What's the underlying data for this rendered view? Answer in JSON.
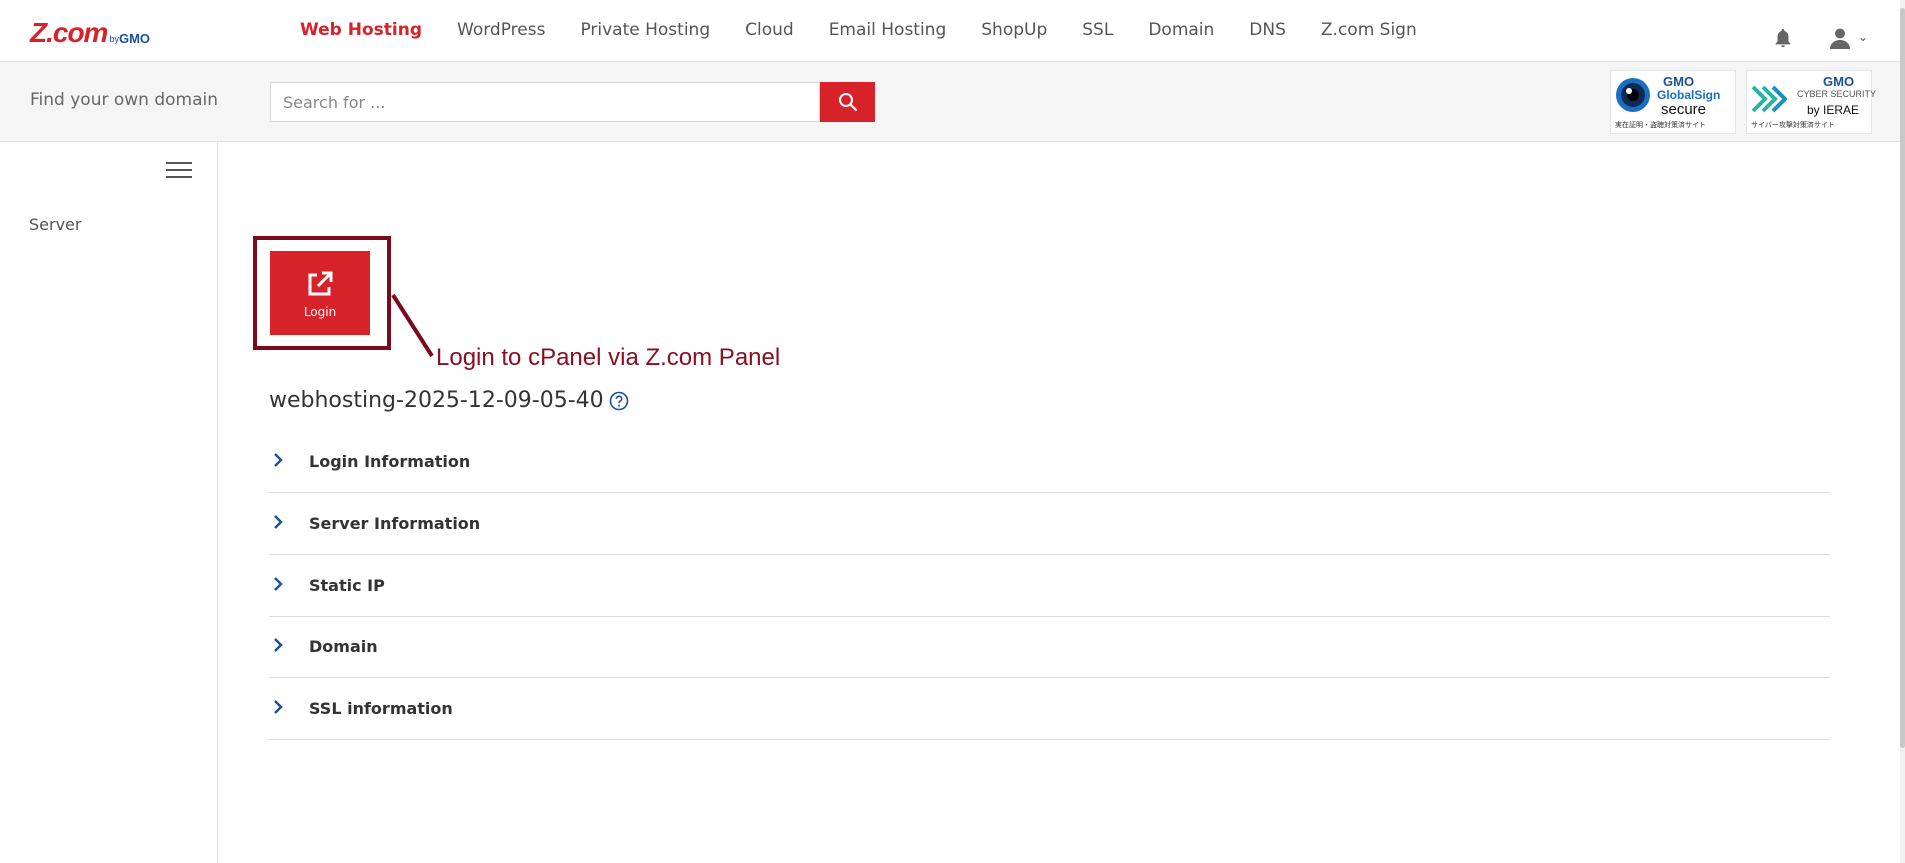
{
  "brand": {
    "logo_main": "Z.com",
    "logo_by": "by",
    "logo_gmo": "GMO",
    "accent_color": "#d8222a"
  },
  "nav": {
    "items": [
      {
        "label": "Web Hosting",
        "active": true
      },
      {
        "label": "WordPress"
      },
      {
        "label": "Private Hosting"
      },
      {
        "label": "Cloud"
      },
      {
        "label": "Email Hosting"
      },
      {
        "label": "ShopUp"
      },
      {
        "label": "SSL"
      },
      {
        "label": "Domain"
      },
      {
        "label": "DNS"
      },
      {
        "label": "Z.com Sign"
      }
    ],
    "icons": [
      "bell-icon",
      "user-icon",
      "chevron-down-icon"
    ]
  },
  "search": {
    "label": "Find your own domain",
    "placeholder": "Search for ...",
    "value": "",
    "button_icon": "search-icon"
  },
  "badges": {
    "globalsign": {
      "line1": "GMO",
      "line2": "GlobalSign",
      "line3": "secure",
      "footer": "実在証明・盗聴対策済サイト"
    },
    "ierae": {
      "line1": "GMO",
      "line2": "CYBER SECURITY",
      "line3": "by IERAE",
      "footer": "サイバー攻撃対策済サイト"
    }
  },
  "sidebar": {
    "menu_icon": "hamburger-icon",
    "items": [
      {
        "label": "Server"
      }
    ]
  },
  "main": {
    "login_button": {
      "label": "Login",
      "icon": "external-link-icon"
    },
    "annotation": {
      "text": "Login to cPanel via Z.com Panel",
      "color": "#8a0f22"
    },
    "server_name": "webhosting-2025-12-09-05-40",
    "sections": [
      {
        "label": "Login Information"
      },
      {
        "label": "Server Information"
      },
      {
        "label": "Static IP"
      },
      {
        "label": "Domain"
      },
      {
        "label": "SSL information"
      }
    ]
  }
}
